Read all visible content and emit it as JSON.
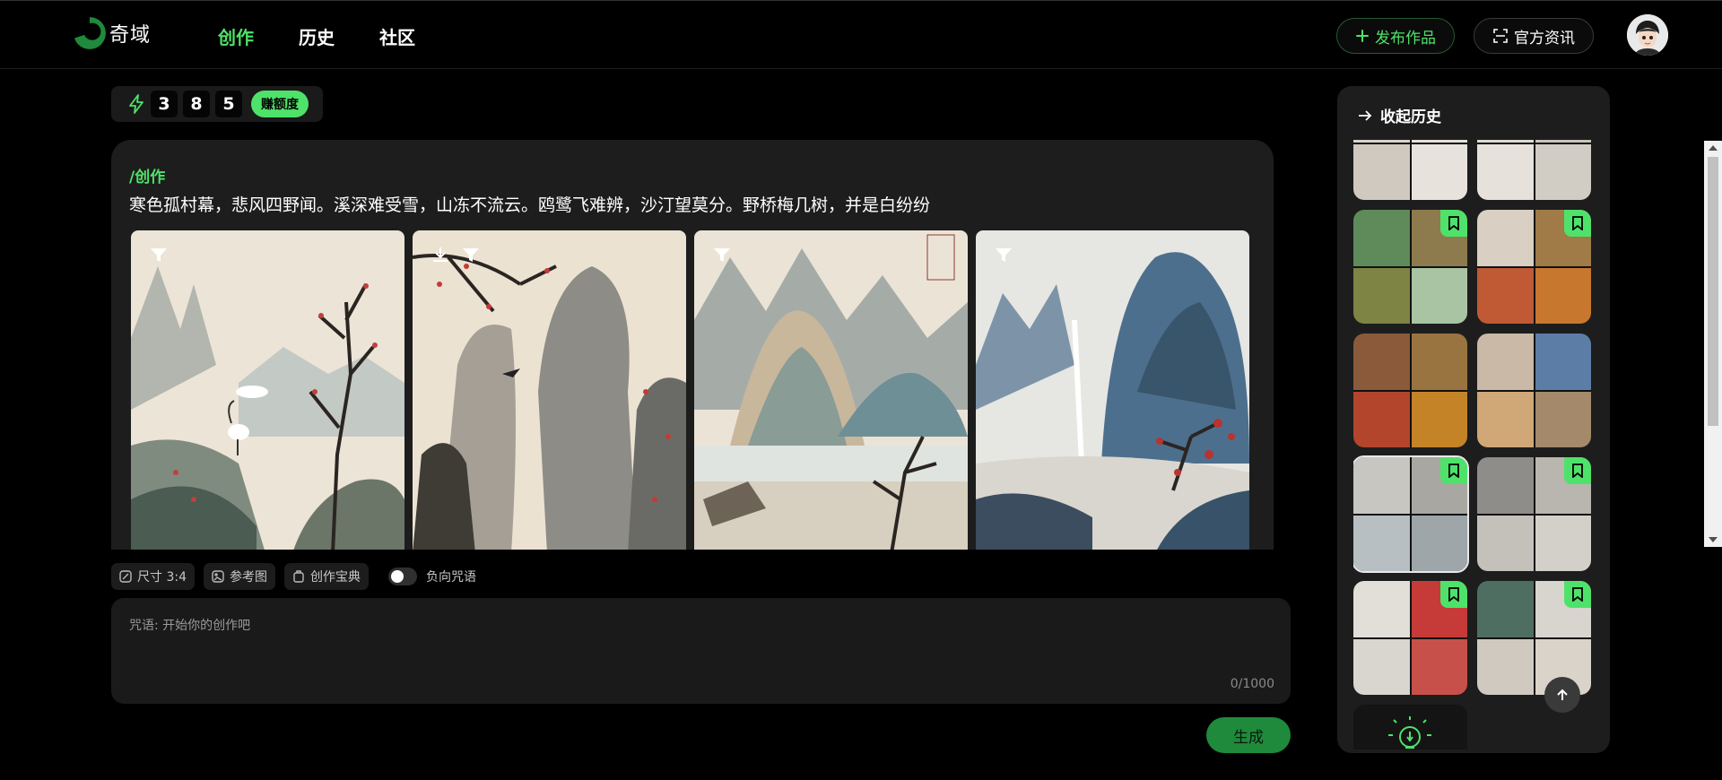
{
  "header": {
    "logo_text": "奇域",
    "nav": [
      {
        "label": "创作",
        "active": true
      },
      {
        "label": "历史",
        "active": false
      },
      {
        "label": "社区",
        "active": false
      }
    ],
    "publish_label": "发布作品",
    "news_label": "官方资讯"
  },
  "credits": {
    "digits": [
      "3",
      "8",
      "5"
    ],
    "earn_label": "赚额度"
  },
  "creation": {
    "command": "/创作",
    "prompt": "寒色孤村幕，悲风四野闻。溪深难受雪，山冻不流云。鸥鹭飞难辨，沙汀望莫分。野桥梅几树，并是白纷纷"
  },
  "options": {
    "size_label": "尺寸 3:4",
    "reference_label": "参考图",
    "guide_label": "创作宝典",
    "negative_label": "负向咒语"
  },
  "input": {
    "placeholder": "咒语: 开始你的创作吧",
    "counter": "0/1000"
  },
  "generate_label": "生成",
  "history": {
    "collapse_label": "收起历史"
  },
  "colors": {
    "accent": "#4fe26a",
    "accent_dark": "#1f8a3b",
    "card_bg": "#1d1d1d"
  }
}
